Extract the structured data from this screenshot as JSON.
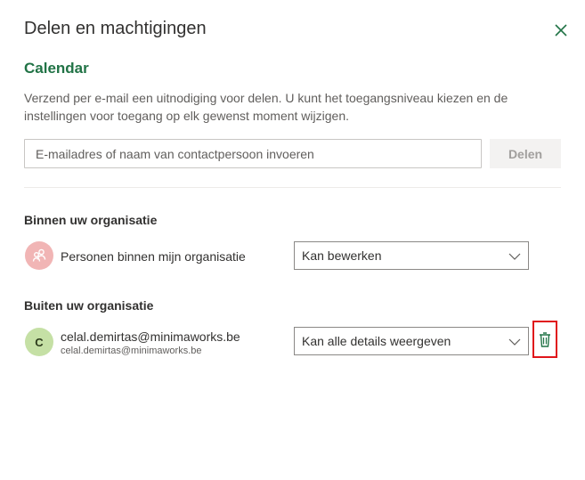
{
  "dialog": {
    "title": "Delen en machtigingen",
    "close_icon": "close-icon"
  },
  "calendar_name": "Calendar",
  "description": "Verzend per e-mail een uitnodiging voor delen. U kunt het toegangsniveau kiezen en de instellingen voor toegang op elk gewenst moment wijzigen.",
  "invite": {
    "placeholder": "E-mailadres of naam van contactpersoon invoeren",
    "value": "",
    "share_label": "Delen"
  },
  "inside_org": {
    "heading": "Binnen uw organisatie",
    "entries": [
      {
        "name": "Personen binnen mijn organisatie",
        "permission": "Kan bewerken",
        "avatar_icon": "people-icon"
      }
    ]
  },
  "outside_org": {
    "heading": "Buiten uw organisatie",
    "entries": [
      {
        "initial": "C",
        "name": "celal.demirtas@minimaworks.be",
        "email": "celal.demirtas@minimaworks.be",
        "permission": "Kan alle details weergeven",
        "action_icon": "trash-icon"
      }
    ]
  },
  "colors": {
    "accent": "#217346",
    "highlight": "#e0161b",
    "avatar_org": "#f1b5b5",
    "avatar_ext": "#c5e0a5"
  }
}
